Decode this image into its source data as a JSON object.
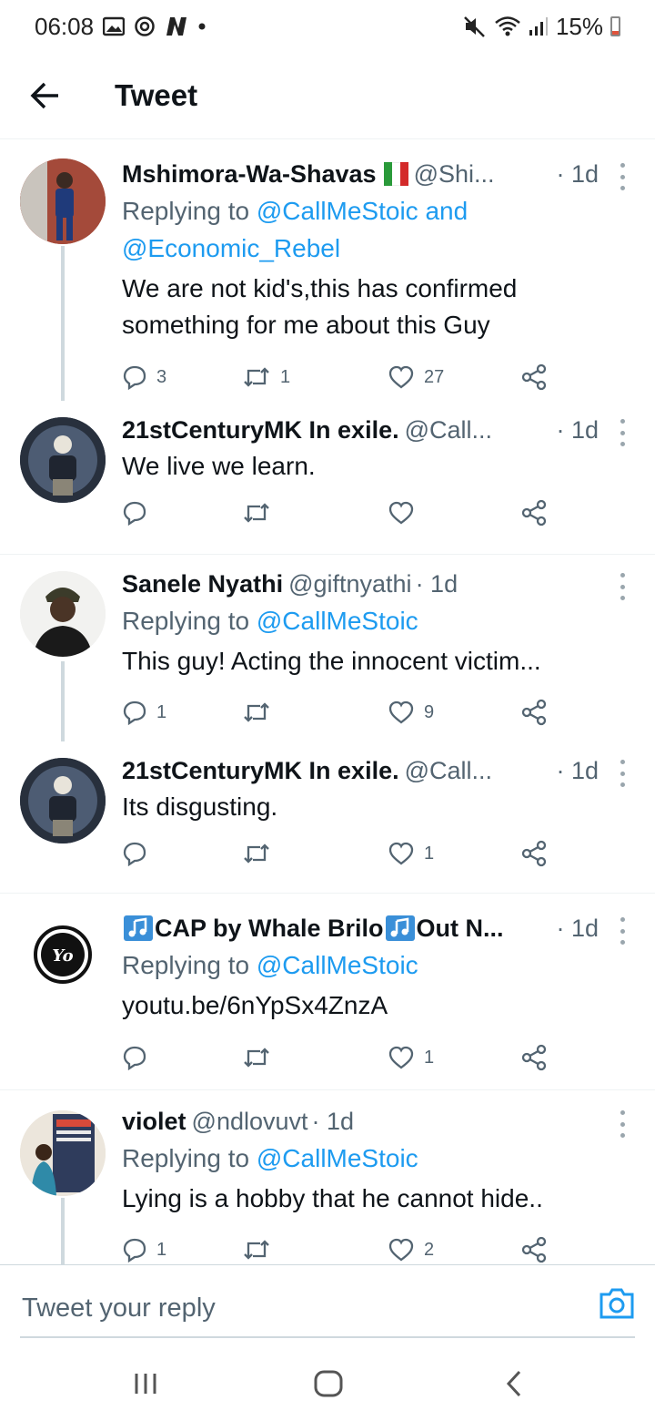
{
  "status_bar": {
    "time": "06:08",
    "battery": "15%",
    "icons_left": [
      "gallery-icon",
      "sync-icon",
      "n-app-icon",
      "dot-icon"
    ],
    "icons_right": [
      "mute-icon",
      "wifi-icon",
      "signal-icon",
      "battery-icon"
    ],
    "battery_level": 0.15
  },
  "header": {
    "title": "Tweet"
  },
  "tweets": [
    {
      "name": "Mshimora-Wa-Shavas",
      "handle": "@Shi...",
      "time": "· 1d",
      "reply_prefix": "Replying to",
      "reply_to_1": "@CallMeStoic",
      "reply_and": " and",
      "reply_to_2": "@Economic_Rebel",
      "text": "We are not kid's,this has confirmed something for me about this Guy",
      "replies": "3",
      "retweets": "1",
      "likes": "27"
    },
    {
      "name": "21stCenturyMK In exile.",
      "handle": "@Call...",
      "time": "· 1d",
      "text": "We live we learn.",
      "replies": "",
      "retweets": "",
      "likes": ""
    },
    {
      "name": "Sanele Nyathi",
      "handle": "@giftnyathi",
      "time": "· 1d",
      "reply_prefix": "Replying to",
      "reply_to_1": "@CallMeStoic",
      "text": "This guy! Acting the innocent victim...",
      "replies": "1",
      "retweets": "",
      "likes": "9"
    },
    {
      "name": "21stCenturyMK In exile.",
      "handle": "@Call...",
      "time": "· 1d",
      "text": "Its disgusting.",
      "replies": "",
      "retweets": "",
      "likes": "1"
    },
    {
      "name": "CAP by Whale Brilo",
      "name_suffix": " Out N...",
      "time": "· 1d",
      "reply_prefix": "Replying to",
      "reply_to_1": "@CallMeStoic",
      "link": "youtu.be/6nYpSx4ZnzA",
      "replies": "",
      "retweets": "",
      "likes": "1"
    },
    {
      "name": "violet",
      "handle": "@ndlovuvt",
      "time": "· 1d",
      "reply_prefix": "Replying to",
      "reply_to_1": "@CallMeStoic",
      "text": "Lying is a hobby that he cannot hide..",
      "replies": "1",
      "retweets": "",
      "likes": "2"
    }
  ],
  "reply_bar": {
    "placeholder": "Tweet your reply"
  },
  "colors": {
    "accent": "#1d9bf0",
    "secondary_text": "#536471",
    "primary_text": "#0f1419"
  }
}
